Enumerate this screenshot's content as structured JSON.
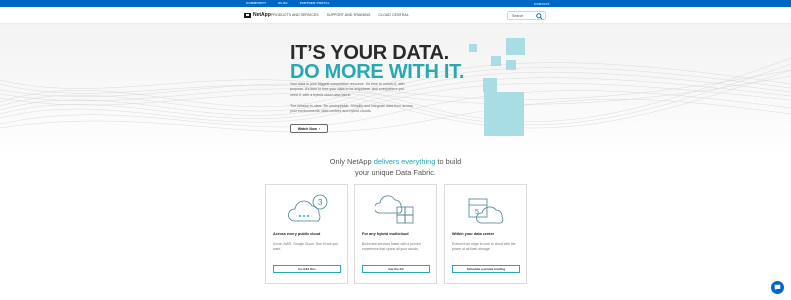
{
  "topbar": {
    "links": [
      "COMMUNITY",
      "BLOG",
      "PARTNER PORTAL"
    ],
    "contact": "CONTACT"
  },
  "nav": {
    "logo_text": "NetApp",
    "menu": [
      "PRODUCTS AND SERVICES",
      "SUPPORT AND TRAINING",
      "CLOUD CENTRAL"
    ],
    "search_placeholder": "Search"
  },
  "hero": {
    "headline_line1": "IT’S YOUR DATA.",
    "headline_line2": "DO MORE WITH IT.",
    "paragraph1": "Your data is your biggest competitive resource. It’s time to unlock it, with purpose. It’s time to free your data to be anywhere, and everywhere you need it, with a hybrid cloud data fabric.",
    "paragraph2": "The mission is clear. Be unstoppable. Simplify and integrate data from across your environments, data centers and hybrid clouds.",
    "watch_button": "Watch Now",
    "accent_color": "#27a8b2",
    "tile_color": "#a8dee3"
  },
  "tagline": {
    "prefix": "Only NetApp ",
    "highlight": "delivers everything",
    "suffix_line1": " to build",
    "line2": "your unique Data Fabric."
  },
  "cards": [
    {
      "title": "Across every public cloud",
      "description": "Azure, AWS, Google Cloud. Run it how you want.",
      "button": "Go Add Ons",
      "icon": "cloud-icon"
    },
    {
      "title": "For any hybrid multicloud",
      "description": "Build new services faster with a proven experience that spans all your clouds.",
      "button": "Get the Kit",
      "icon": "hybrid-cloud-icon"
    },
    {
      "title": "Within your data center",
      "description": "Extend from edge to core to cloud with the power of all flash storage.",
      "button": "Schedule a private briefing",
      "icon": "datacenter-cloud-icon"
    }
  ]
}
